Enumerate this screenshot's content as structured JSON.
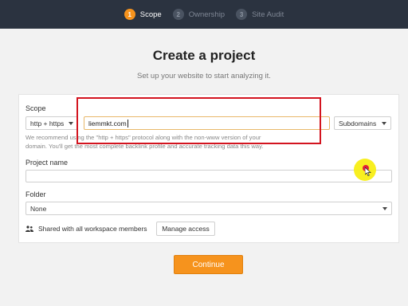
{
  "steps": [
    {
      "num": "1",
      "label": "Scope",
      "state": "active"
    },
    {
      "num": "2",
      "label": "Ownership",
      "state": "inactive"
    },
    {
      "num": "3",
      "label": "Site Audit",
      "state": "inactive"
    }
  ],
  "page": {
    "title": "Create a project",
    "subtitle": "Set up your website to start analyzing it."
  },
  "scope": {
    "label": "Scope",
    "protocol_value": "http + https",
    "domain_value": "liemmkt.com",
    "subdomains_value": "Subdomains",
    "hint_line1": "We recommend using the \"http + https\" protocol along with the non-www version of your",
    "hint_line2": "domain. You'll get the most complete backlink profile and accurate tracking data this way."
  },
  "project_name": {
    "label": "Project name",
    "value": ""
  },
  "folder": {
    "label": "Folder",
    "value": "None"
  },
  "sharing": {
    "text": "Shared with all workspace members",
    "manage_label": "Manage access"
  },
  "actions": {
    "continue_label": "Continue"
  },
  "colors": {
    "topbar": "#2b3340",
    "accent": "#f6931d",
    "highlight_box": "#d3141f",
    "cursor_highlight": "#f8ee14"
  }
}
